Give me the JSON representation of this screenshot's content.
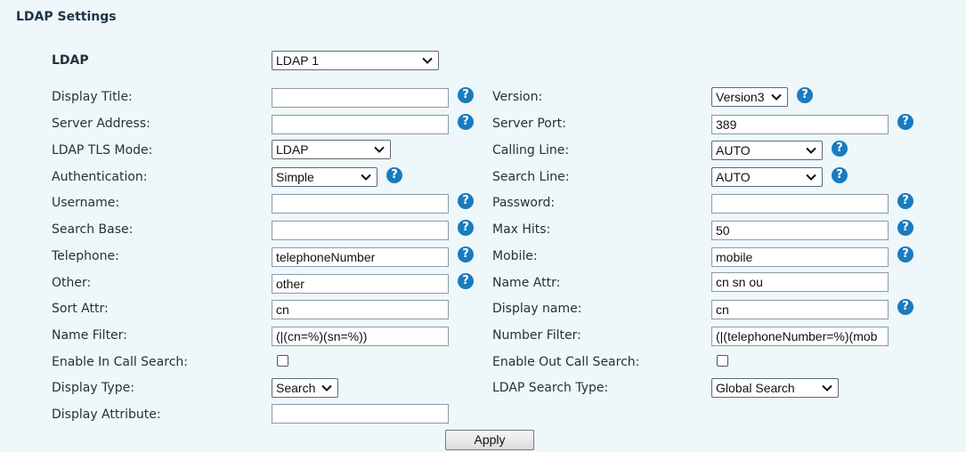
{
  "section_title": "LDAP Settings",
  "ldap": {
    "label": "LDAP",
    "value": "LDAP 1"
  },
  "left": {
    "display_title": {
      "label": "Display Title:",
      "value": ""
    },
    "server_address": {
      "label": "Server Address:",
      "value": ""
    },
    "tls_mode": {
      "label": "LDAP TLS Mode:",
      "value": "LDAP"
    },
    "authentication": {
      "label": "Authentication:",
      "value": "Simple"
    },
    "username": {
      "label": "Username:",
      "value": ""
    },
    "search_base": {
      "label": "Search Base:",
      "value": ""
    },
    "telephone": {
      "label": "Telephone:",
      "value": "telephoneNumber"
    },
    "other": {
      "label": "Other:",
      "value": "other"
    },
    "sort_attr": {
      "label": "Sort Attr:",
      "value": "cn"
    },
    "name_filter": {
      "label": "Name Filter:",
      "value": "(|(cn=%)(sn=%))"
    },
    "in_call_search": {
      "label": "Enable In Call Search:",
      "checked": false
    },
    "display_type": {
      "label": "Display Type:",
      "value": "Search"
    },
    "display_attribute": {
      "label": "Display Attribute:",
      "value": ""
    }
  },
  "right": {
    "version": {
      "label": "Version:",
      "value": "Version3"
    },
    "server_port": {
      "label": "Server Port:",
      "value": "389"
    },
    "calling_line": {
      "label": "Calling Line:",
      "value": "AUTO"
    },
    "search_line": {
      "label": "Search Line:",
      "value": "AUTO"
    },
    "password": {
      "label": "Password:",
      "value": ""
    },
    "max_hits": {
      "label": "Max Hits:",
      "value": "50"
    },
    "mobile": {
      "label": "Mobile:",
      "value": "mobile"
    },
    "name_attr": {
      "label": "Name Attr:",
      "value": "cn sn ou"
    },
    "display_name": {
      "label": "Display name:",
      "value": "cn"
    },
    "number_filter": {
      "label": "Number Filter:",
      "value": "(|(telephoneNumber=%)(mob"
    },
    "out_call_search": {
      "label": "Enable Out Call Search:",
      "checked": false
    },
    "search_type": {
      "label": "LDAP Search Type:",
      "value": "Global Search"
    }
  },
  "apply_label": "Apply",
  "help_glyph": "?",
  "icons": {
    "help": "help-icon",
    "dropdown": "chevron-down-icon"
  },
  "colors": {
    "background": "#eef7fa",
    "help_icon": "#1a7bbf"
  }
}
